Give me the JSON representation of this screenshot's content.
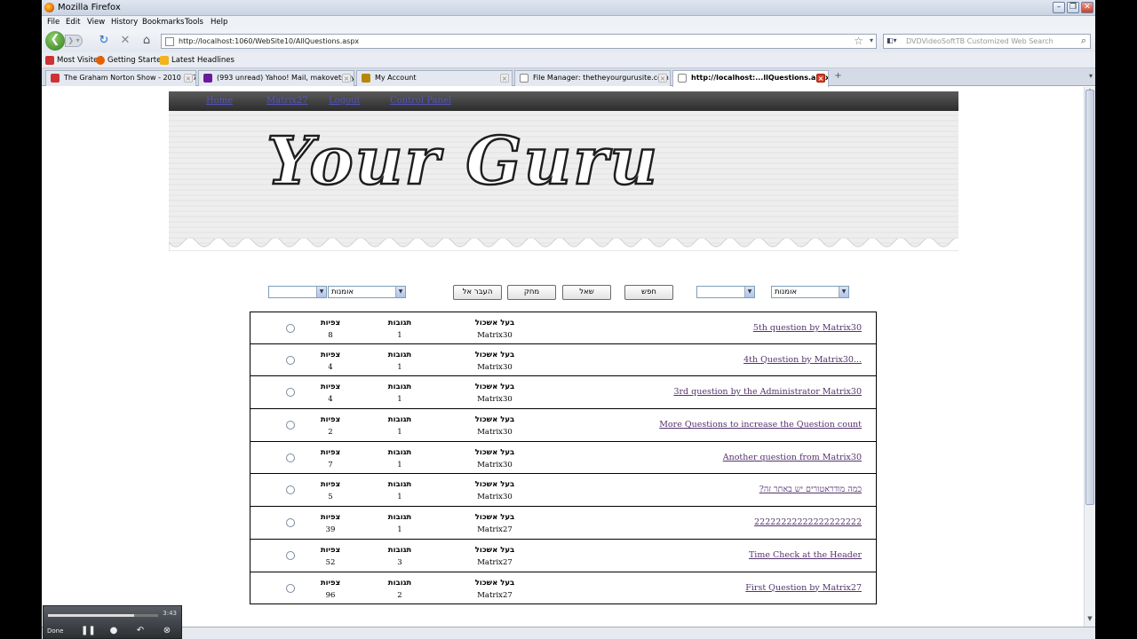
{
  "window": {
    "title": "Mozilla Firefox"
  },
  "menu": [
    "File",
    "Edit",
    "View",
    "History",
    "Bookmarks",
    "Tools",
    "Help"
  ],
  "address": {
    "url": "http://localhost:1060/WebSite10/AllQuestions.aspx"
  },
  "search": {
    "placeholder": "DVDVideoSoftTB Customized Web Search"
  },
  "bookmarks": [
    "Most Visited",
    "Getting Started",
    "Latest Headlines"
  ],
  "tabs": [
    {
      "label": "The Graham Norton Show - 2010 - S7x...",
      "active": false
    },
    {
      "label": "(993 unread) Yahoo! Mail, makovetskiyd",
      "active": false
    },
    {
      "label": "My Account",
      "active": false
    },
    {
      "label": "File Manager: thetheyourgurusite.com",
      "active": false
    },
    {
      "label": "http://localhost:...llQuestions.aspx",
      "active": true
    }
  ],
  "site": {
    "nav": [
      "Home",
      "Matrix27",
      "Logout",
      "Control Panel"
    ],
    "banner_title": "Your Guru"
  },
  "filters": {
    "select_left_category": "אומנות",
    "select_right_category": "אומנות",
    "buttons": [
      "העבר אל",
      "מחק",
      "שאל",
      "חפש"
    ]
  },
  "table_labels": {
    "views": "צפיות",
    "answers": "תגובות",
    "owner": "בעל אשכול"
  },
  "questions": [
    {
      "title": "5th question by Matrix30",
      "owner": "Matrix30",
      "answers": "1",
      "views": "8"
    },
    {
      "title": "4th Question by Matrix30...",
      "owner": "Matrix30",
      "answers": "1",
      "views": "4"
    },
    {
      "title": "3rd question by the Administrator Matrix30",
      "owner": "Matrix30",
      "answers": "1",
      "views": "4"
    },
    {
      "title": "More Questions to increase the Question count",
      "owner": "Matrix30",
      "answers": "1",
      "views": "2"
    },
    {
      "title": "Another question from Matrix30",
      "owner": "Matrix30",
      "answers": "1",
      "views": "7"
    },
    {
      "title": "?כמה מודראטורים יש באתר זה",
      "owner": "Matrix30",
      "answers": "1",
      "views": "5"
    },
    {
      "title": "22222222222222222222",
      "owner": "Matrix27",
      "answers": "1",
      "views": "39"
    },
    {
      "title": "Time Check at the Header",
      "owner": "Matrix27",
      "answers": "3",
      "views": "52"
    },
    {
      "title": "First Question by Matrix27",
      "owner": "Matrix27",
      "answers": "2",
      "views": "96"
    }
  ],
  "media": {
    "time": "3:43",
    "progress": 0.78,
    "status": "Done"
  }
}
